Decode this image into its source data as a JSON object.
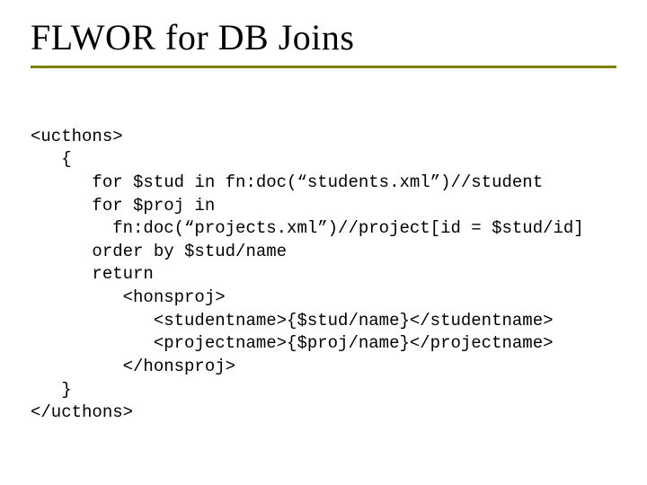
{
  "title": "FLWOR for DB Joins",
  "code_lines": [
    "<ucthons>",
    "   {",
    "      for $stud in fn:doc(“students.xml”)//student",
    "      for $proj in",
    "        fn:doc(“projects.xml”)//project[id = $stud/id]",
    "      order by $stud/name",
    "      return",
    "         <honsproj>",
    "            <studentname>{$stud/name}</studentname>",
    "            <projectname>{$proj/name}</projectname>",
    "         </honsproj>",
    "   }",
    "</ucthons>"
  ]
}
